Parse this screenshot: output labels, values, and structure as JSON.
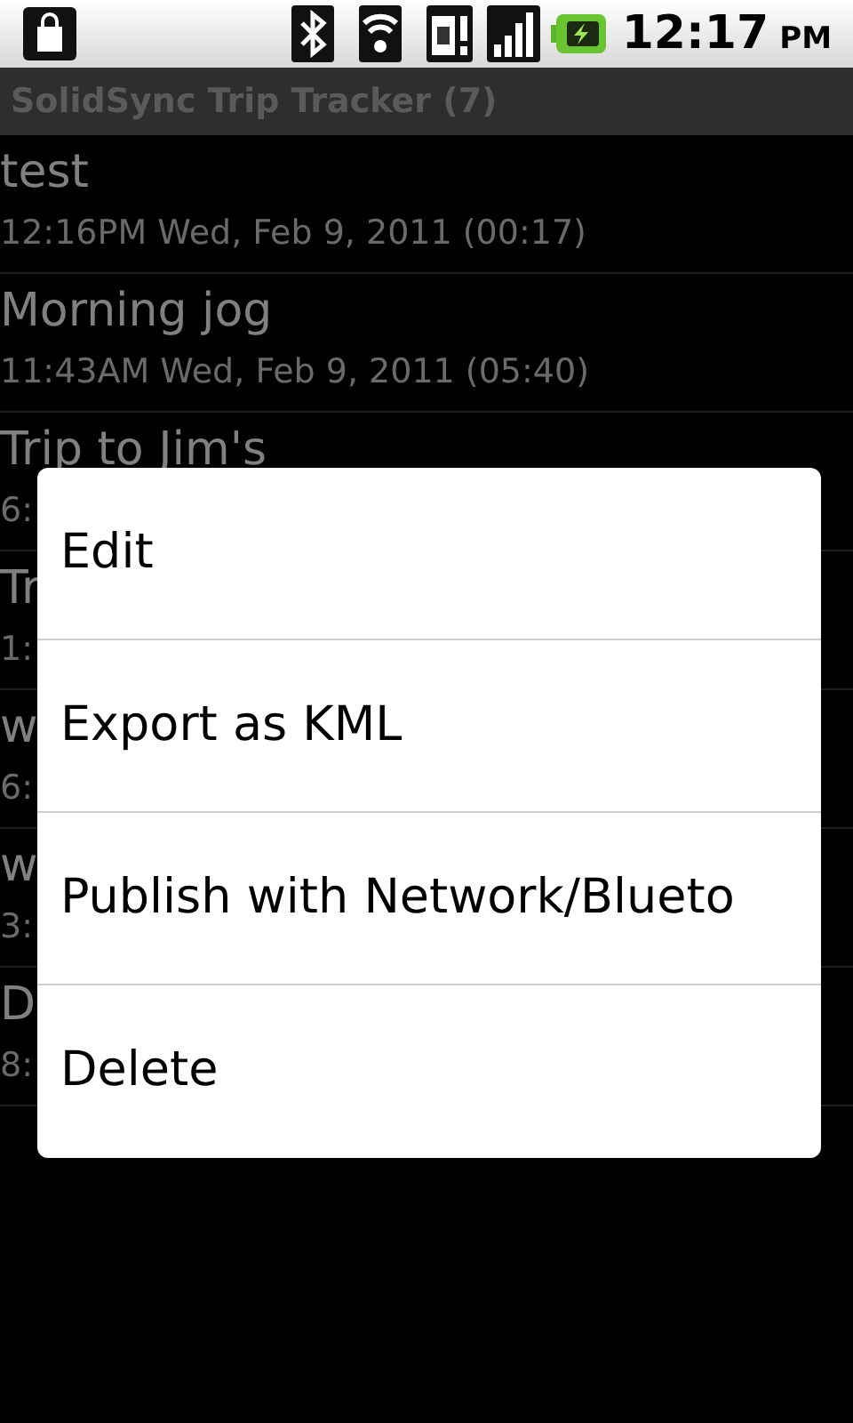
{
  "status_bar": {
    "time": "12:17",
    "meridiem": "PM"
  },
  "title_bar": {
    "title": "SolidSync Trip Tracker (7)"
  },
  "trips": [
    {
      "title": "test",
      "subtitle": "12:16PM Wed, Feb 9, 2011 (00:17)"
    },
    {
      "title": "Morning jog",
      "subtitle": "11:43AM Wed, Feb 9, 2011 (05:40)"
    },
    {
      "title": "Trip to Jim's",
      "subtitle": "6:"
    },
    {
      "title": "Tr",
      "subtitle": "1:"
    },
    {
      "title": "w",
      "subtitle": "6:"
    },
    {
      "title": "w",
      "subtitle": "3:"
    },
    {
      "title": "D",
      "subtitle": "8:"
    }
  ],
  "context_menu": {
    "items": [
      "Edit",
      "Export as KML",
      "Publish with Network/Blueto",
      "Delete"
    ]
  }
}
